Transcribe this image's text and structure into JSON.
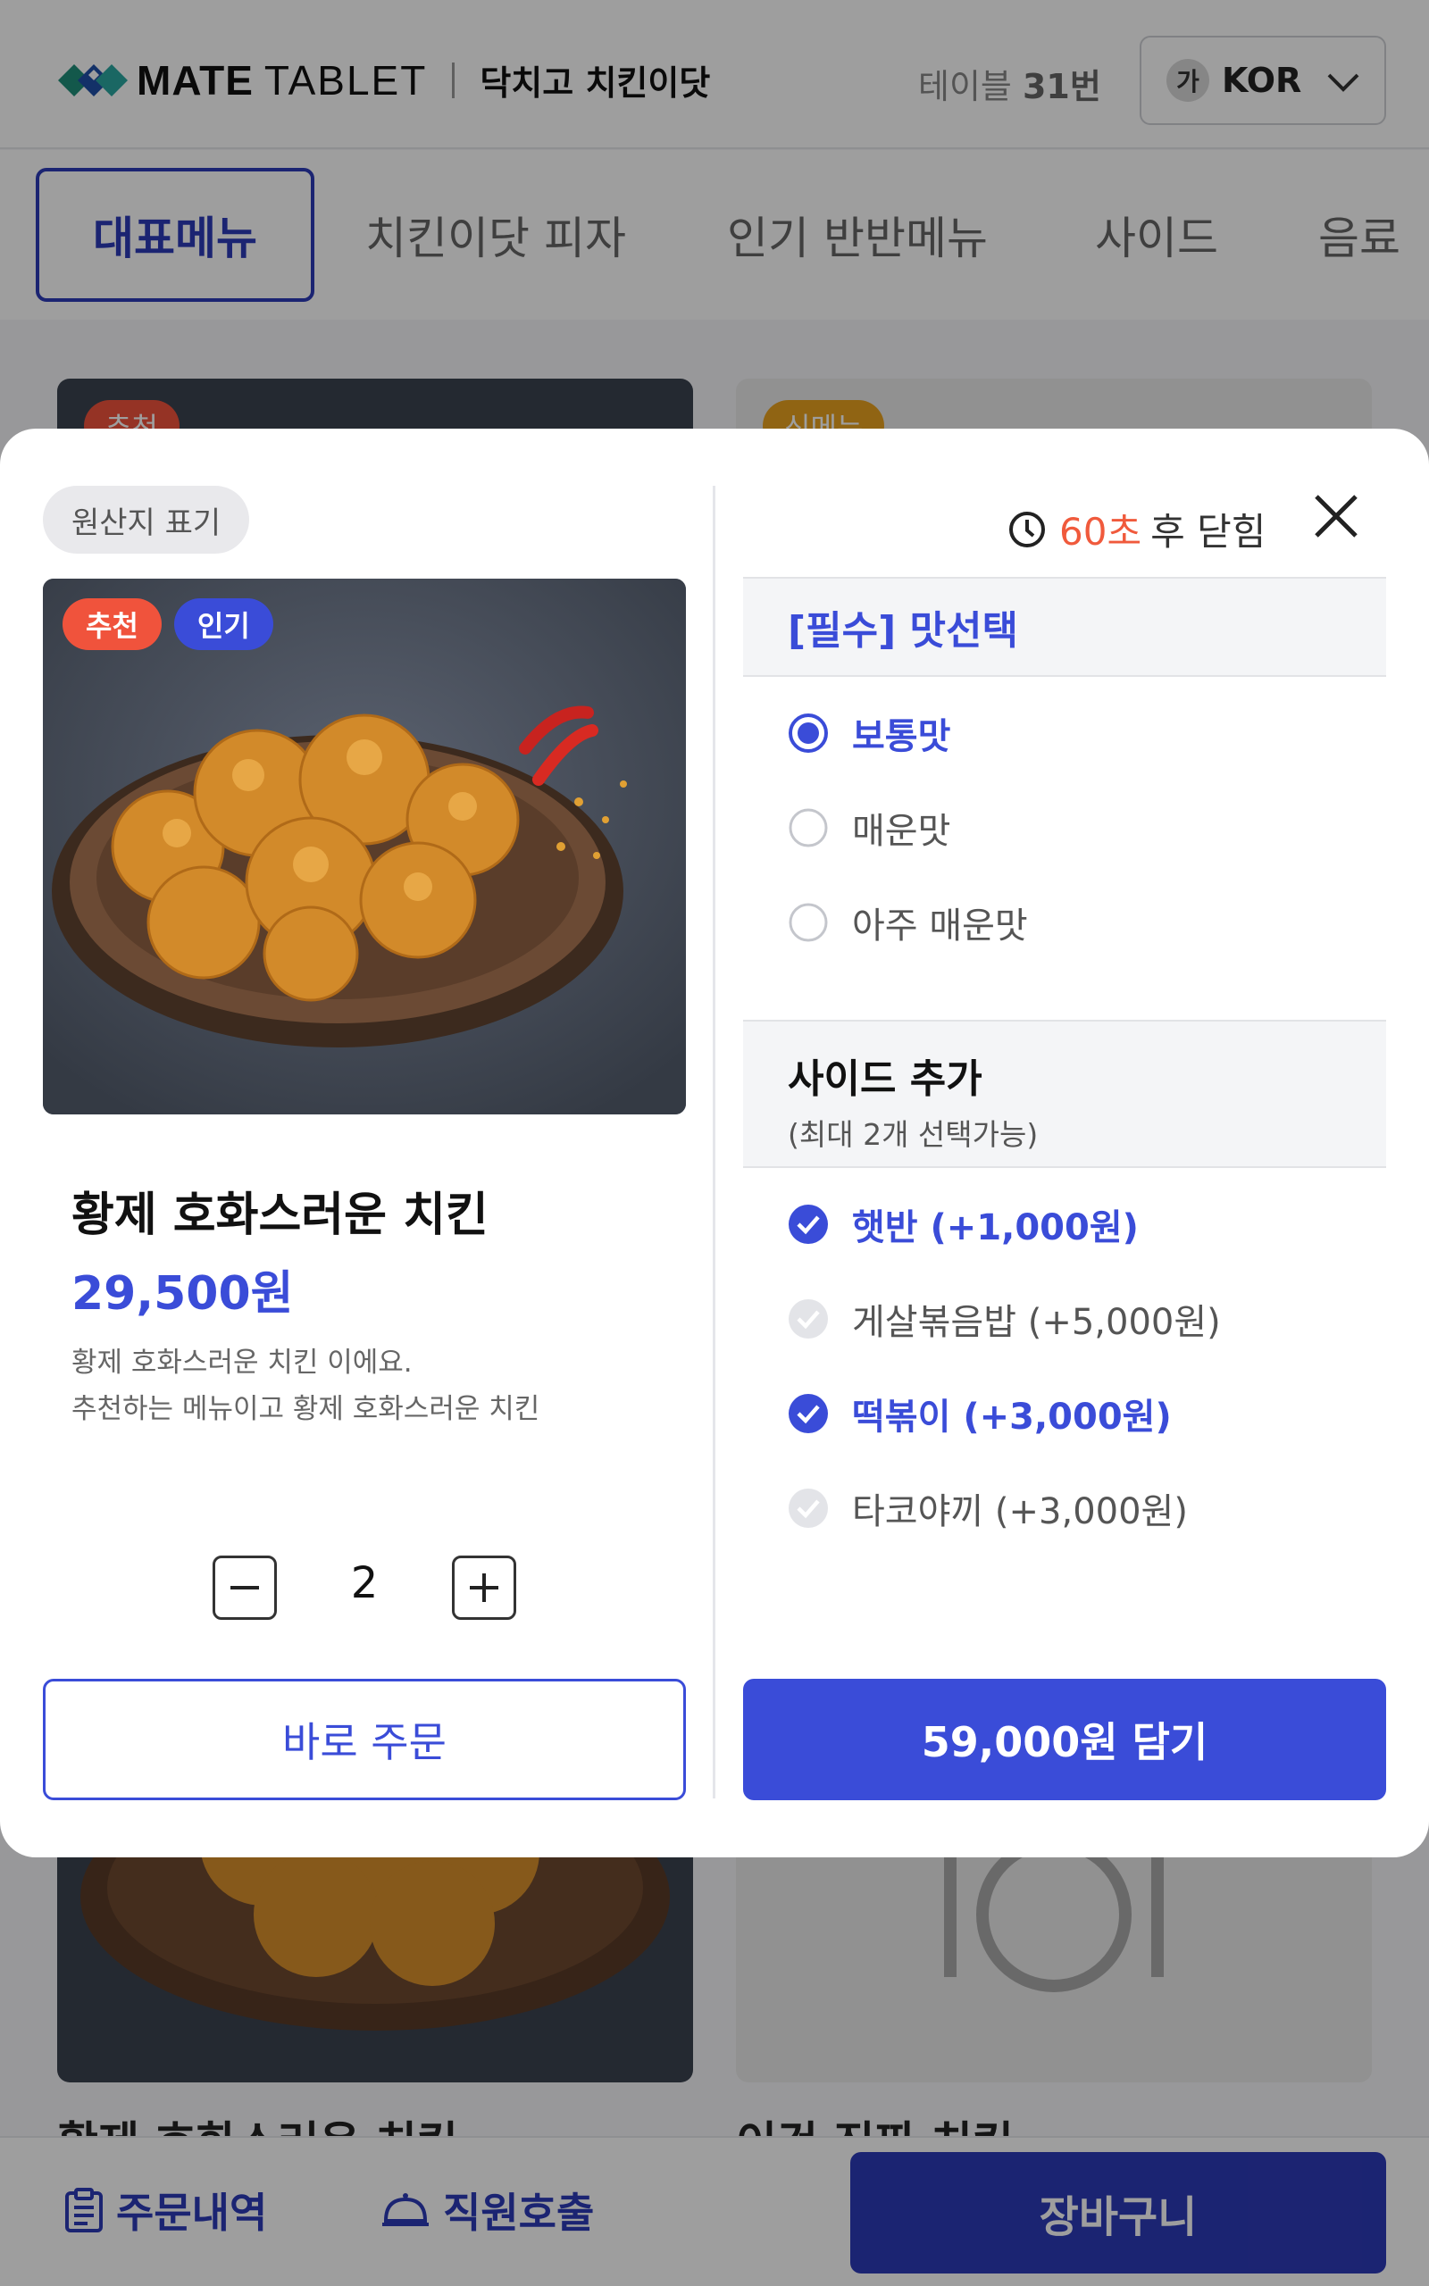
{
  "header": {
    "logo_strong": "MATE",
    "logo_light": "TABLET",
    "store_name": "닥치고 치킨이닷",
    "table_prefix": "테이블 ",
    "table_number": "31번",
    "lang_badge": "가",
    "lang_label": "KOR"
  },
  "tabs": [
    "대표메뉴",
    "치킨이닷 피자",
    "인기 반반메뉴",
    "사이드",
    "음료"
  ],
  "background_cards": {
    "left_badge": "추천",
    "right_badge": "신메뉴",
    "left_name": "황제 호화스러운 치킨",
    "right_name": "이건 진짜 치킨"
  },
  "bottom_bar": {
    "order_history": "주문내역",
    "staff_call": "직원호출",
    "cart": "장바구니"
  },
  "modal": {
    "origin_label": "원산지 표기",
    "badges": [
      "추천",
      "인기"
    ],
    "product": {
      "name": "황제 호화스러운 치킨",
      "price": "29,500원",
      "desc_line1": "황제 호화스러운 치킨 이에요.",
      "desc_line2": "추천하는 메뉴이고 황제 호화스러운 치킨"
    },
    "quantity": "2",
    "timer": {
      "seconds": "60초",
      "tail": "후 닫힘"
    },
    "required_section": {
      "title": "[필수] 맛선택",
      "options": [
        {
          "label": "보통맛",
          "selected": true
        },
        {
          "label": "매운맛",
          "selected": false
        },
        {
          "label": "아주 매운맛",
          "selected": false
        }
      ]
    },
    "side_section": {
      "title": "사이드 추가",
      "subtitle": "(최대 2개 선택가능)",
      "options": [
        {
          "label": "햇반 (+1,000원)",
          "checked": true
        },
        {
          "label": "게살볶음밥 (+5,000원)",
          "checked": false
        },
        {
          "label": "떡볶이 (+3,000원)",
          "checked": true
        },
        {
          "label": "타코야끼 (+3,000원)",
          "checked": false
        }
      ]
    },
    "order_now_label": "바로 주문",
    "add_cart_label": "59,000원 담기"
  },
  "colors": {
    "accent": "#3a4cd8",
    "nav_accent": "#2d3ab8",
    "timer_red": "#f05a3c",
    "badge_recommend": "#f0533c",
    "badge_popular": "#3a4cd8"
  }
}
